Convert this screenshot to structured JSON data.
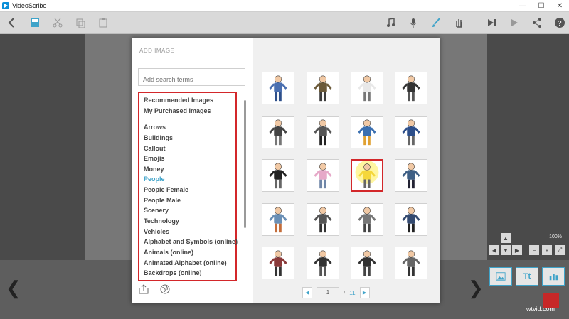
{
  "window": {
    "title": "VideoScribe",
    "controls": [
      "—",
      "☐",
      "✕"
    ]
  },
  "toolbar": {
    "icons": [
      "back-icon",
      "save-icon",
      "cut-icon",
      "copy-icon",
      "paste-icon",
      "music-icon",
      "mic-icon",
      "brush-icon",
      "hand-icon",
      "play-from-icon",
      "play-icon",
      "share-icon",
      "help-icon"
    ]
  },
  "dialog": {
    "title": "ADD IMAGE",
    "close": "✕",
    "search_placeholder": "Add search terms",
    "categories_top": [
      "Recommended Images",
      "My Purchased Images"
    ],
    "categories": [
      "Arrows",
      "Buildings",
      "Callout",
      "Emojis",
      "Money",
      "People",
      "People Female",
      "People Male",
      "Scenery",
      "Technology",
      "Vehicles",
      "Alphabet and Symbols (online)",
      "Animals (online)",
      "Animated Alphabet (online)",
      "Backdrops (online)"
    ],
    "active_category": "People",
    "pager": {
      "current": "1",
      "separator": "/",
      "total": "11"
    }
  },
  "thumbnails": [
    "man-headache",
    "man-meditating",
    "man-juggling",
    "man-jumping",
    "man-celebrating",
    "man-cycling",
    "man-relaxing",
    "man-running",
    "man-standing",
    "woman-standing",
    "man-spotlight",
    "man-walking",
    "woman-meditating",
    "man-suit",
    "man-arms-up",
    "man-tie",
    "woman-dress",
    "woman-walking",
    "woman-shrug",
    "woman-flex"
  ],
  "selected_thumbnail_index": 10,
  "zoom": {
    "level": "100%"
  },
  "right_panel": {
    "text_button": "Tt"
  },
  "watermark": "wtvid.com",
  "colors": {
    "accent": "#3fa3c9",
    "selection": "#d3272a"
  }
}
